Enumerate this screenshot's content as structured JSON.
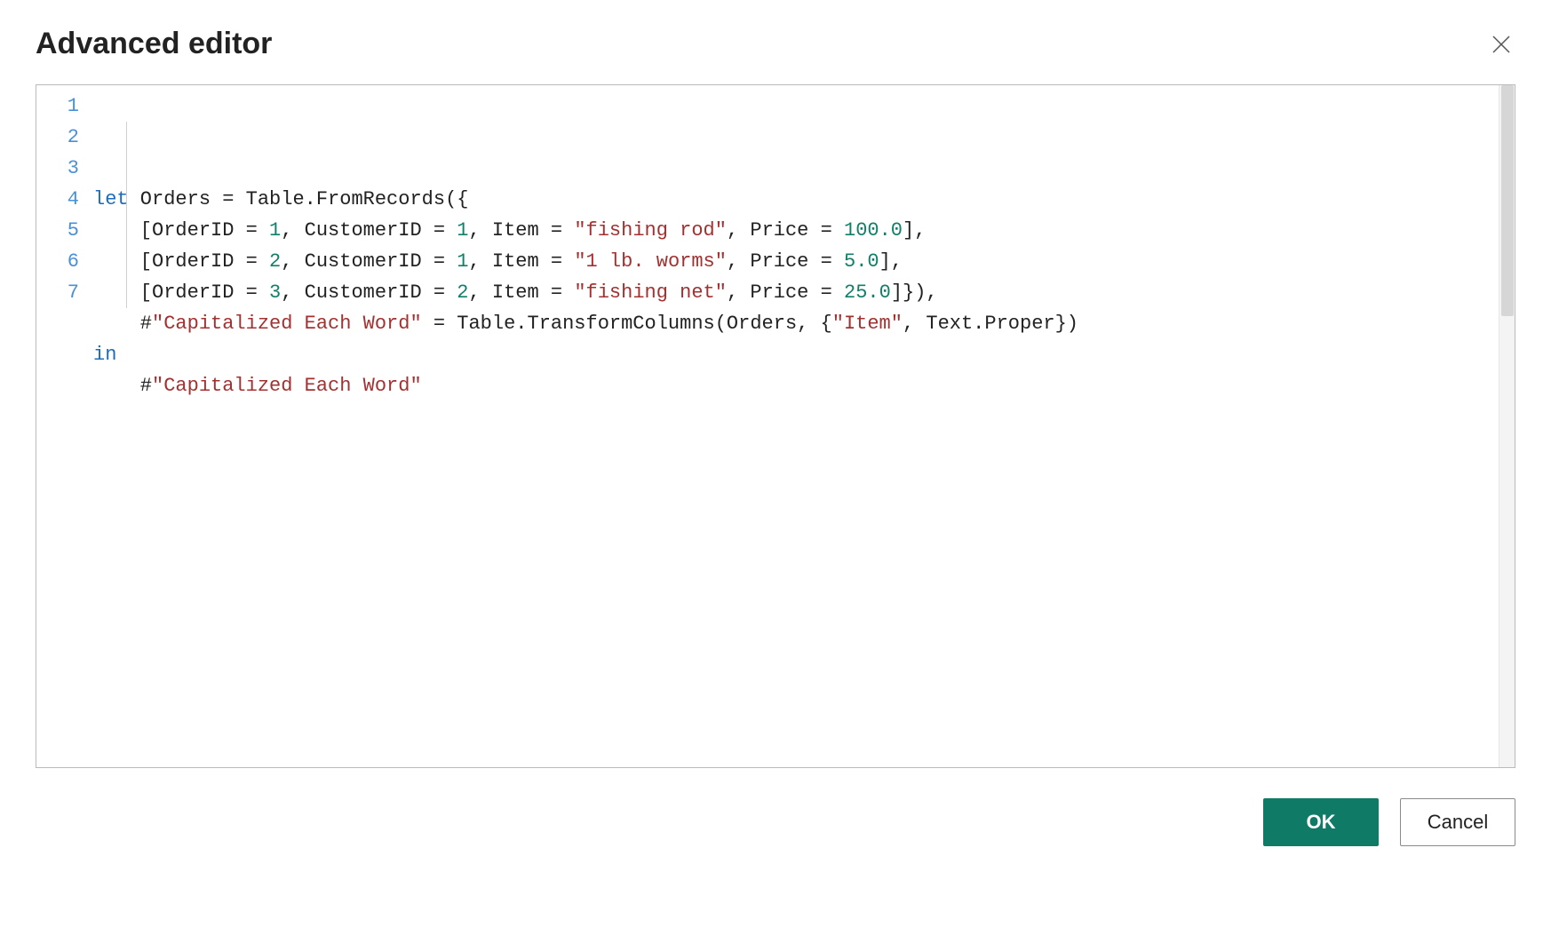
{
  "dialog": {
    "title": "Advanced editor",
    "ok_label": "OK",
    "cancel_label": "Cancel"
  },
  "editor": {
    "line_numbers": [
      "1",
      "2",
      "3",
      "4",
      "5",
      "6",
      "7"
    ],
    "lines": [
      {
        "indent": 0,
        "tokens": [
          {
            "t": "kw",
            "v": "let"
          },
          {
            "t": "p",
            "v": " Orders = Table.FromRecords({"
          }
        ]
      },
      {
        "indent": 1,
        "tokens": [
          {
            "t": "p",
            "v": "[OrderID = "
          },
          {
            "t": "num",
            "v": "1"
          },
          {
            "t": "p",
            "v": ", CustomerID = "
          },
          {
            "t": "num",
            "v": "1"
          },
          {
            "t": "p",
            "v": ", Item = "
          },
          {
            "t": "str",
            "v": "\"fishing rod\""
          },
          {
            "t": "p",
            "v": ", Price = "
          },
          {
            "t": "num",
            "v": "100.0"
          },
          {
            "t": "p",
            "v": "],"
          }
        ]
      },
      {
        "indent": 1,
        "tokens": [
          {
            "t": "p",
            "v": "[OrderID = "
          },
          {
            "t": "num",
            "v": "2"
          },
          {
            "t": "p",
            "v": ", CustomerID = "
          },
          {
            "t": "num",
            "v": "1"
          },
          {
            "t": "p",
            "v": ", Item = "
          },
          {
            "t": "str",
            "v": "\"1 lb. worms\""
          },
          {
            "t": "p",
            "v": ", Price = "
          },
          {
            "t": "num",
            "v": "5.0"
          },
          {
            "t": "p",
            "v": "],"
          }
        ]
      },
      {
        "indent": 1,
        "tokens": [
          {
            "t": "p",
            "v": "[OrderID = "
          },
          {
            "t": "num",
            "v": "3"
          },
          {
            "t": "p",
            "v": ", CustomerID = "
          },
          {
            "t": "num",
            "v": "2"
          },
          {
            "t": "p",
            "v": ", Item = "
          },
          {
            "t": "str",
            "v": "\"fishing net\""
          },
          {
            "t": "p",
            "v": ", Price = "
          },
          {
            "t": "num",
            "v": "25.0"
          },
          {
            "t": "p",
            "v": "]}),"
          }
        ]
      },
      {
        "indent": 1,
        "tokens": [
          {
            "t": "p",
            "v": "#"
          },
          {
            "t": "str",
            "v": "\"Capitalized Each Word\""
          },
          {
            "t": "p",
            "v": " = Table.TransformColumns(Orders, {"
          },
          {
            "t": "str",
            "v": "\"Item\""
          },
          {
            "t": "p",
            "v": ", Text.Proper})"
          }
        ]
      },
      {
        "indent": 0,
        "tokens": [
          {
            "t": "kw",
            "v": "in"
          }
        ]
      },
      {
        "indent": 1,
        "tokens": [
          {
            "t": "p",
            "v": "#"
          },
          {
            "t": "str",
            "v": "\"Capitalized Each Word\""
          }
        ]
      }
    ]
  }
}
